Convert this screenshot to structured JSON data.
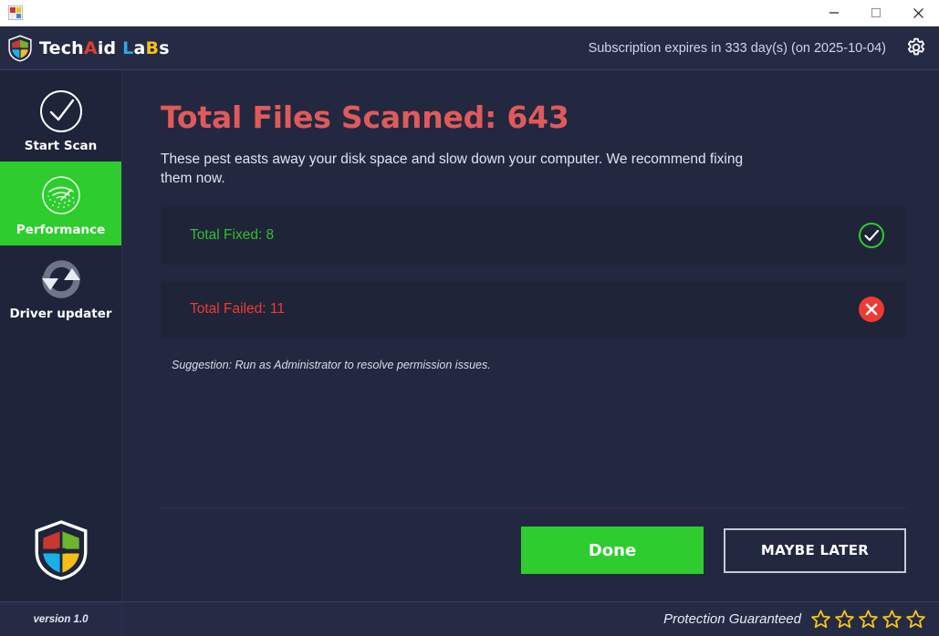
{
  "window": {
    "app_icon": "app-tiles-icon",
    "minimize_label": "minimize-icon",
    "maximize_label": "maximize-icon",
    "close_label": "close-icon"
  },
  "header": {
    "brand": {
      "part1": "Tech",
      "part2": "A",
      "part3": "id ",
      "part4": "L",
      "part5": "a",
      "part6": "B",
      "part7": "s",
      "shield_icon": "shield-logo-icon"
    },
    "subscription_text": "Subscription expires in 333 day(s) (on 2025-10-04)",
    "settings_icon": "gear-icon"
  },
  "sidebar": {
    "items": [
      {
        "label": "Start Scan",
        "icon": "check-circle-icon",
        "active": false
      },
      {
        "label": "Performance",
        "icon": "gauge-radar-icon",
        "active": true
      },
      {
        "label": "Driver updater",
        "icon": "refresh-sync-icon",
        "active": false
      }
    ],
    "logo_icon": "shield-logo-icon"
  },
  "main": {
    "title": "Total Files Scanned: 643",
    "subtitle": "These pest easts away your disk space and slow down your computer. We recommend fixing them now.",
    "rows": [
      {
        "label": "Total Fixed: 8",
        "state": "ok",
        "icon": "check-circle-outline-icon"
      },
      {
        "label": "Total Failed: 11",
        "state": "bad",
        "icon": "x-circle-filled-icon"
      }
    ],
    "suggestion": "Suggestion: Run as Administrator to resolve permission issues.",
    "primary_button": "Done",
    "secondary_button": "MAYBE LATER"
  },
  "footer": {
    "version": "version 1.0",
    "guarantee": "Protection Guaranteed",
    "stars": 5,
    "star_icon": "star-outline-icon"
  },
  "colors": {
    "accent_green": "#2ecc2e",
    "danger_red": "#ef3a33",
    "title_red": "#e05a5a",
    "success_green": "#2fbf2f",
    "background": "#222840",
    "sidebar": "#1e2439",
    "header": "#252b45",
    "card": "#1f2438",
    "star_gold": "#f5c518"
  }
}
